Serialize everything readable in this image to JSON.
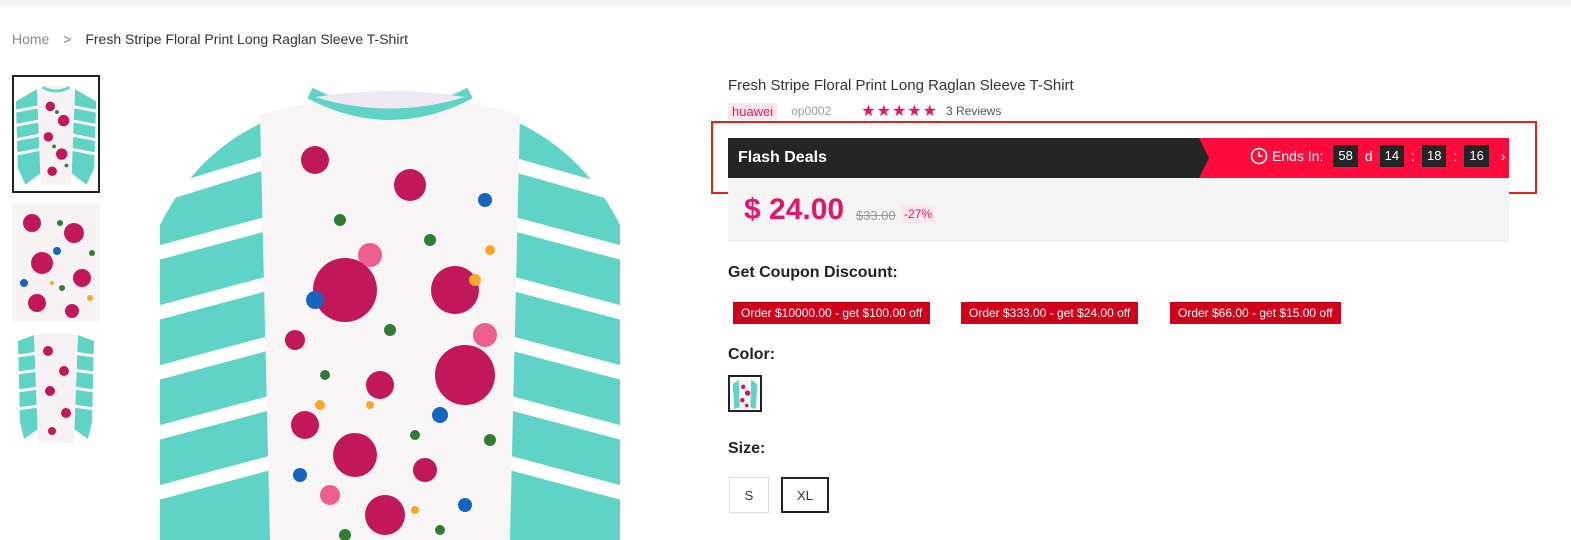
{
  "breadcrumb": {
    "home": "Home",
    "separator": ">",
    "current": "Fresh Stripe Floral Print Long Raglan Sleeve T-Shirt"
  },
  "product": {
    "title": "Fresh Stripe Floral Print Long Raglan Sleeve T-Shirt",
    "brand": "huawei",
    "sku": "op0002",
    "rating_stars": "★★★★★",
    "rating_value": 5,
    "reviews": "3 Reviews"
  },
  "flash": {
    "title": "Flash Deals",
    "ends_label": "Ends In:",
    "days": "58",
    "days_unit": "d",
    "hours": "14",
    "minutes": "18",
    "seconds": "16",
    "colon": ":",
    "next_glyph": "›"
  },
  "pricing": {
    "price": "$ 24.00",
    "old_price": "$33.00",
    "discount": "-27%"
  },
  "coupons": {
    "label": "Get Coupon Discount:",
    "items": [
      "Order $10000.00 - get $100.00 off",
      "Order $333.00 - get $24.00 off",
      "Order $66.00 - get $15.00 off"
    ]
  },
  "color": {
    "label": "Color:"
  },
  "size": {
    "label": "Size:",
    "options": [
      "S",
      "XL"
    ],
    "selected": "XL"
  },
  "colors": {
    "accent": "#e4156b",
    "flash_red": "#ff0a3a",
    "coupon_red": "#d0021b",
    "dark": "#252525",
    "shirt_teal": "#5fd3c6"
  },
  "icons": {
    "clock": "clock-icon",
    "next": "chevron-right-icon"
  }
}
